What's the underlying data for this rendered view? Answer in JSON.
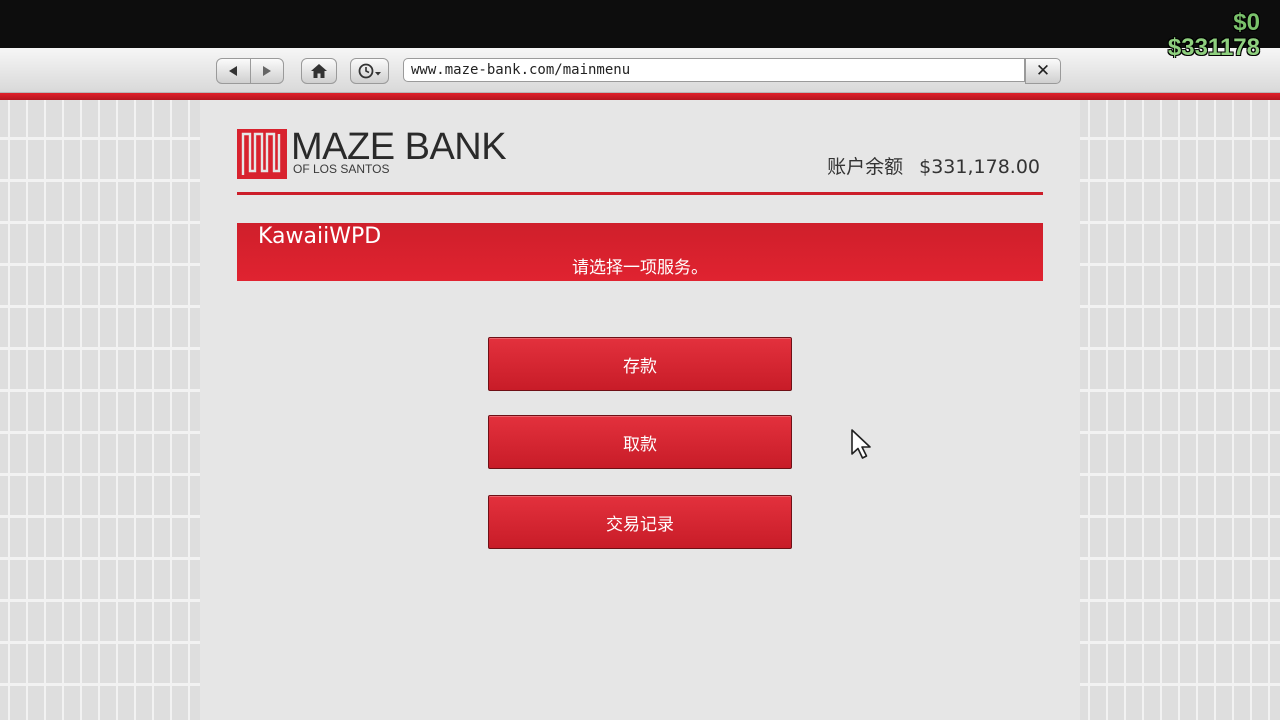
{
  "hud": {
    "cash": "$0",
    "bank": "$331178"
  },
  "browser": {
    "back_icon": "back-arrow-icon",
    "forward_icon": "forward-arrow-icon",
    "home_icon": "home-icon",
    "history_icon": "clock-history-icon",
    "url": "www.maze-bank.com/mainmenu",
    "close_label": "✕"
  },
  "bank": {
    "logo_title": "MAZE BANK",
    "logo_subtitle": "OF LOS SANTOS",
    "balance_label": "账户余额",
    "balance_value": "$331,178.00",
    "username": "KawaiiWPD",
    "prompt": "请选择一项服务。",
    "menu": [
      {
        "label": "存款"
      },
      {
        "label": "取款"
      },
      {
        "label": "交易记录"
      }
    ]
  },
  "colors": {
    "accent": "#d8222e",
    "background": "#e6e6e6",
    "hud_green": "#7ac26b"
  }
}
